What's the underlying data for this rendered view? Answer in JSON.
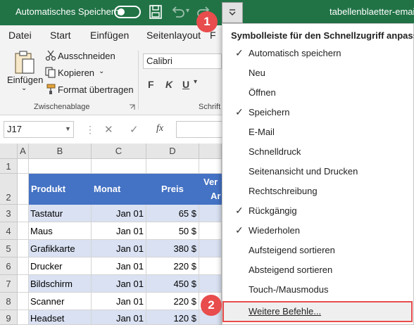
{
  "titlebar": {
    "autosave_label": "Automatisches Speichern",
    "doc_title": "tabellenblaetter-email-"
  },
  "icons": [
    "save-icon",
    "undo-icon",
    "redo-icon",
    "chevron-down-icon",
    "paste-icon",
    "cut-icon",
    "copy-icon",
    "format-painter-icon",
    "dialog-launcher-icon"
  ],
  "colors": {
    "excel_green": "#217346",
    "table_header": "#4472c4",
    "band": "#d9e1f2",
    "badge": "#e84c4c"
  },
  "tabs": [
    "Datei",
    "Start",
    "Einfügen",
    "Seitenlayout",
    "F"
  ],
  "ribbon": {
    "paste_label": "Einfügen",
    "cut_label": "Ausschneiden",
    "copy_label": "Kopieren",
    "format_painter_label": "Format übertragen",
    "group_label": "Zwischenablage",
    "font_name": "Calibri",
    "font_group_partial": "Schrift",
    "fmt_bold": "F",
    "fmt_italic": "K",
    "fmt_underline": "U"
  },
  "formula_bar": {
    "namebox": "J17",
    "cancel": "✕",
    "enter": "✓",
    "fx": "fx"
  },
  "grid": {
    "col_headers": [
      "A",
      "B",
      "C",
      "D"
    ],
    "row_headers": [
      "1",
      "2",
      "3",
      "4",
      "5",
      "6",
      "7",
      "8",
      "9"
    ],
    "table_headers": {
      "produkt": "Produkt",
      "monat": "Monat",
      "preis": "Preis",
      "partial_1": "Ver",
      "partial_2": "Ar"
    },
    "rows": [
      {
        "produkt": "Tastatur",
        "monat": "Jan 01",
        "preis": "65 $"
      },
      {
        "produkt": "Maus",
        "monat": "Jan 01",
        "preis": "50 $"
      },
      {
        "produkt": "Grafikkarte",
        "monat": "Jan 01",
        "preis": "380 $"
      },
      {
        "produkt": "Drucker",
        "monat": "Jan 01",
        "preis": "220 $"
      },
      {
        "produkt": "Bildschirm",
        "monat": "Jan 01",
        "preis": "450 $"
      },
      {
        "produkt": "Scanner",
        "monat": "Jan 01",
        "preis": "220 $"
      },
      {
        "produkt": "Headset",
        "monat": "Jan 01",
        "preis": "120 $"
      }
    ]
  },
  "menu": {
    "title": "Symbolleiste für den Schnellzugriff anpassen",
    "items": [
      {
        "label": "Automatisch speichern",
        "checked": true
      },
      {
        "label": "Neu",
        "checked": false
      },
      {
        "label": "Öffnen",
        "checked": false
      },
      {
        "label": "Speichern",
        "checked": true
      },
      {
        "label": "E-Mail",
        "checked": false
      },
      {
        "label": "Schnelldruck",
        "checked": false
      },
      {
        "label": "Seitenansicht und Drucken",
        "checked": false
      },
      {
        "label": "Rechtschreibung",
        "checked": false
      },
      {
        "label": "Rückgängig",
        "checked": true
      },
      {
        "label": "Wiederholen",
        "checked": true
      },
      {
        "label": "Aufsteigend sortieren",
        "checked": false
      },
      {
        "label": "Absteigend sortieren",
        "checked": false
      },
      {
        "label": "Touch-/Mausmodus",
        "checked": false
      }
    ],
    "more_commands": "Weitere Befehle..."
  },
  "badges": [
    "1",
    "2"
  ]
}
